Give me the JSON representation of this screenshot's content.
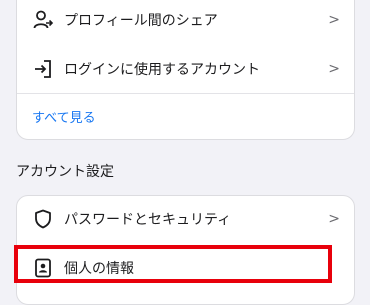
{
  "top_card": {
    "items": [
      {
        "label": "プロフィール間のシェア",
        "icon": "person-share-icon"
      },
      {
        "label": "ログインに使用するアカウント",
        "icon": "login-arrow-icon"
      }
    ],
    "see_all": "すべて見る"
  },
  "account_settings": {
    "title": "アカウント設定",
    "items": [
      {
        "label": "パスワードとセキュリティ",
        "icon": "shield-icon"
      },
      {
        "label": "個人の情報",
        "icon": "id-card-icon"
      }
    ]
  },
  "chevron_glyph": ">",
  "colors": {
    "link": "#1877f2",
    "highlight": "#e8000b",
    "background": "#f2f2f7"
  }
}
